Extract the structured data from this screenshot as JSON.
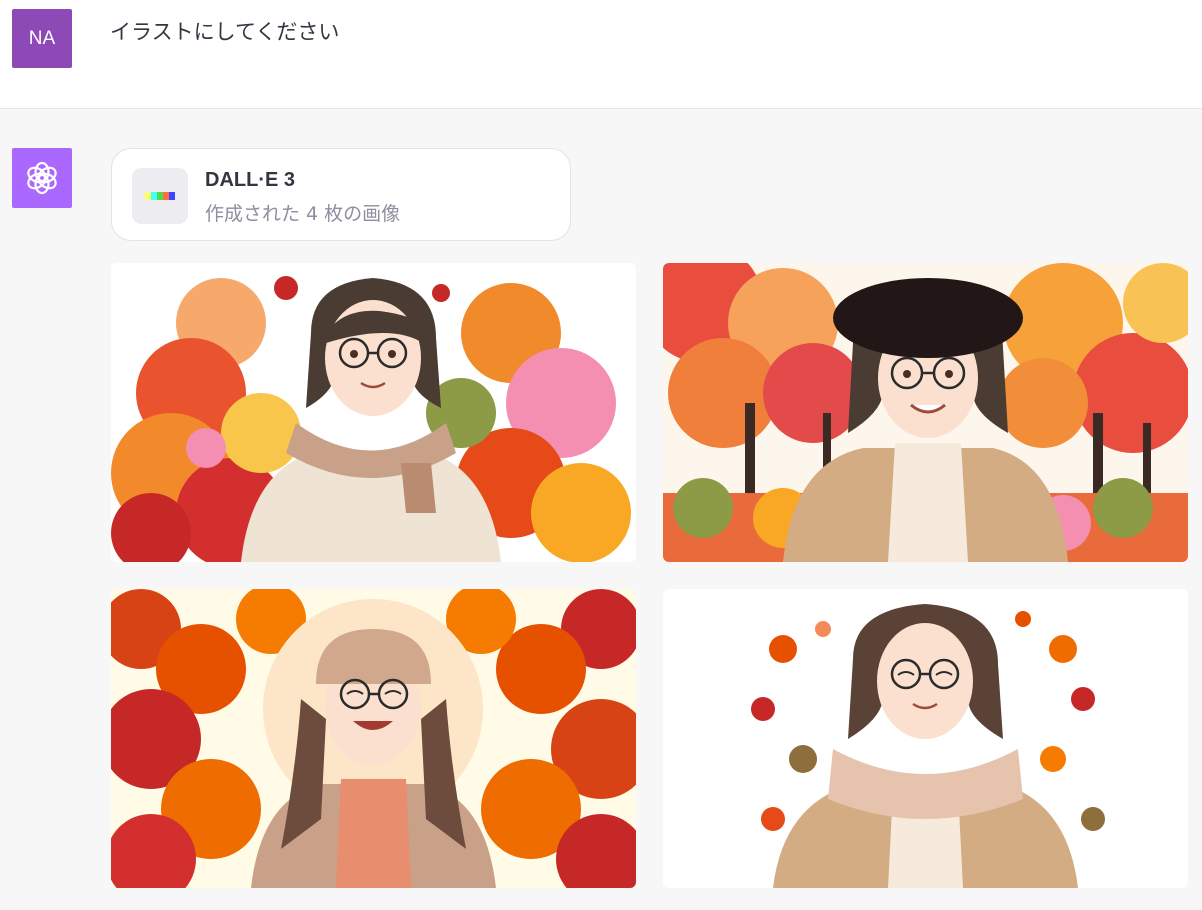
{
  "user_message": {
    "avatar_initials": "NA",
    "text": "イラストにしてください"
  },
  "assistant": {
    "avatar_icon": "openai-logo-icon",
    "tool_card": {
      "title": "DALL·E 3",
      "subtitle": "作成された 4 枚の画像",
      "icon": "dalle-color-bar-icon"
    },
    "images": [
      {
        "name": "generated-image-1"
      },
      {
        "name": "generated-image-2"
      },
      {
        "name": "generated-image-3"
      },
      {
        "name": "generated-image-4"
      }
    ]
  },
  "colors": {
    "user_avatar": "#8d49b6",
    "bot_avatar": "#ab68ff",
    "background": "#f7f7f8",
    "dalle_bar": [
      "#ffff66",
      "#42ffff",
      "#51da4c",
      "#ff6e3c",
      "#3c46ff"
    ]
  }
}
